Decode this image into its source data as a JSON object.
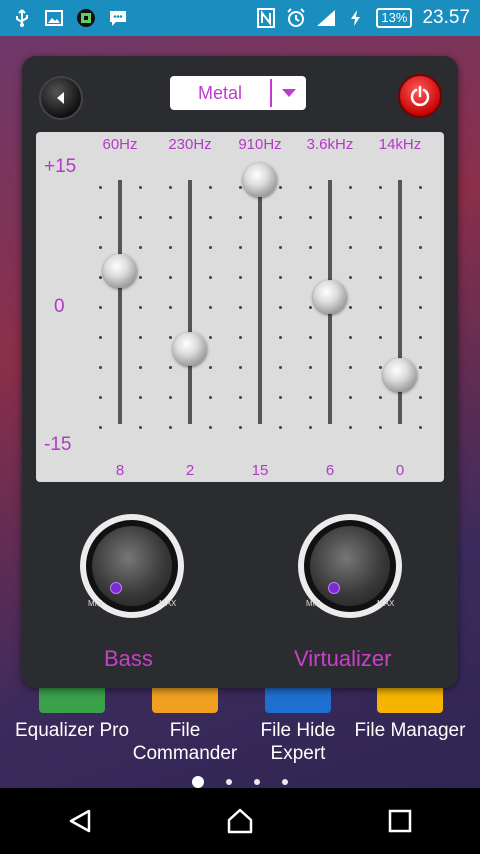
{
  "status_bar": {
    "icons_left": [
      "usb-icon",
      "image-icon",
      "app-icon",
      "message-icon"
    ],
    "icons_right": [
      "nfc-icon",
      "alarm-icon",
      "signal-icon",
      "charging-icon"
    ],
    "battery": "13%",
    "time": "23.57"
  },
  "equalizer": {
    "preset": "Metal",
    "scale": {
      "top": "+15",
      "mid": "0",
      "bottom": "-15"
    },
    "bands": [
      {
        "freq": "60Hz",
        "value": "8",
        "level": 8
      },
      {
        "freq": "230Hz",
        "value": "2",
        "level": 2
      },
      {
        "freq": "910Hz",
        "value": "15",
        "level": 15
      },
      {
        "freq": "3.6kHz",
        "value": "6",
        "level": 6
      },
      {
        "freq": "14kHz",
        "value": "0",
        "level": 0
      }
    ],
    "bass": {
      "label": "Bass",
      "min": "MIN",
      "max": "MAX"
    },
    "virtualizer": {
      "label": "Virtualizer",
      "min": "MIN",
      "max": "MAX"
    }
  },
  "home": {
    "apps": [
      {
        "label": "Equalizer Pro",
        "color": "#3aa04a"
      },
      {
        "label": "File Commander",
        "color": "#f0a020"
      },
      {
        "label": "File Hide Expert",
        "color": "#1f6fd0"
      },
      {
        "label": "File Manager",
        "color": "#f5b400"
      }
    ],
    "page_dots": 4,
    "active_dot": 0
  },
  "colors": {
    "accent": "#c03ad0",
    "statusbar": "#1a8fbf"
  }
}
